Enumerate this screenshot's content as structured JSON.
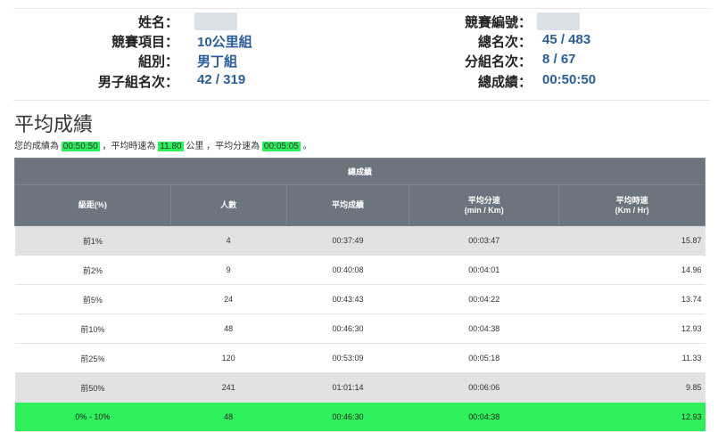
{
  "profile": {
    "name_label": "姓名：",
    "event_label": "競賽項目：",
    "event_value": "10公里組",
    "group_label": "組別：",
    "group_value": "男丁組",
    "group_rank_label": "男子組名次：",
    "group_rank_value": "42 / 319",
    "bib_label": "競賽編號：",
    "overall_rank_label": "總名次：",
    "overall_rank_value": "45 / 483",
    "division_rank_label": "分組名次：",
    "division_rank_value": "8 / 67",
    "total_time_label": "總成績：",
    "total_time_value": "00:50:50"
  },
  "average": {
    "title": "平均成績",
    "s1": "您的成績為",
    "total": "00:50:50",
    "s2": "，平均時速為",
    "speed": "11.80",
    "s3": "公里 ，平均分速為",
    "pace": "00:05:05",
    "s4": "。"
  },
  "table": {
    "group_header": "總成績",
    "headers": [
      "級距(%)",
      "人數",
      "平均成績",
      "平均分速",
      "(min / Km)",
      "平均時速",
      "(Km / Hr)"
    ],
    "rows": [
      [
        "前1%",
        "4",
        "00:37:49",
        "00:03:47",
        "15.87"
      ],
      [
        "前2%",
        "9",
        "00:40:08",
        "00:04:01",
        "14.96"
      ],
      [
        "前5%",
        "24",
        "00:43:43",
        "00:04:22",
        "13.74"
      ],
      [
        "前10%",
        "48",
        "00:46:30",
        "00:04:38",
        "12.93"
      ],
      [
        "前25%",
        "120",
        "00:53:09",
        "00:05:18",
        "11.33"
      ],
      [
        "前50%",
        "241",
        "01:01:14",
        "00:06:06",
        "9.85"
      ],
      [
        "0% - 10%",
        "48",
        "00:46:30",
        "00:04:38",
        "12.93"
      ]
    ]
  }
}
